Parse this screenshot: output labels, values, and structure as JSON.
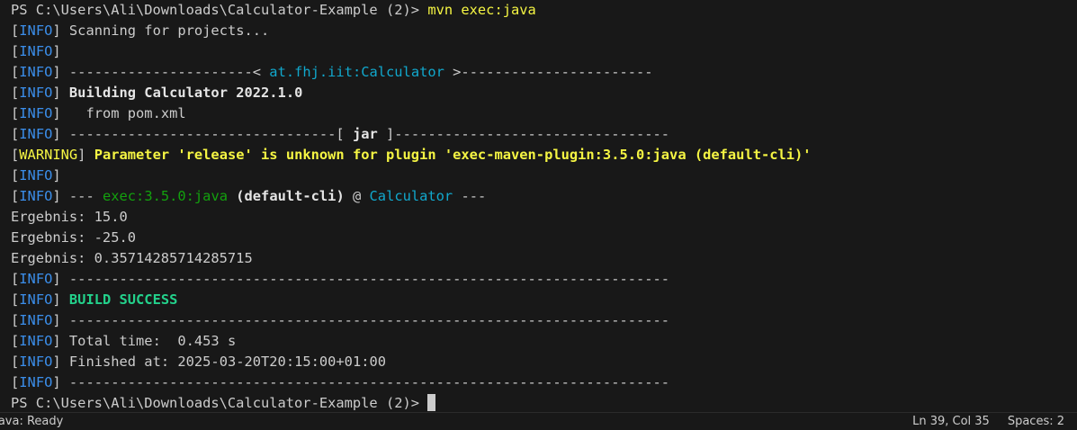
{
  "terminal": {
    "prompt_path": "PS C:\\Users\\Ali\\Downloads\\Calculator-Example (2)> ",
    "command": "mvn exec:java",
    "info_tag": "INFO",
    "warning_tag": "WARNING",
    "lines": {
      "scanning": " Scanning for projects...",
      "dash_left_1": " ----------------------< ",
      "artifact": "at.fhj.iit:Calculator",
      "dash_right_1": " >-----------------------",
      "building": " Building Calculator 2022.1.0",
      "from_pom": "   from pom.xml",
      "dash_left_2": " --------------------------------[ ",
      "jar": "jar",
      "dash_right_2": " ]---------------------------------",
      "warning_msg": " Parameter 'release' is unknown for plugin 'exec-maven-plugin:3.5.0:java (default-cli)'",
      "exec_prefix": " --- ",
      "exec_goal": "exec:3.5.0:java",
      "exec_cli": " (default-cli)",
      "exec_at": " @ ",
      "exec_project": "Calculator",
      "exec_suffix": " ---",
      "result_1": "Ergebnis: 15.0",
      "result_2": "Ergebnis: -25.0",
      "result_3": "Ergebnis: 0.35714285714285715",
      "separator": " ------------------------------------------------------------------------",
      "build_success": " BUILD SUCCESS",
      "total_time": " Total time:  0.453 s",
      "finished_at": " Finished at: 2025-03-20T20:15:00+01:00"
    },
    "final_prompt": "PS C:\\Users\\Ali\\Downloads\\Calculator-Example (2)> "
  },
  "statusbar": {
    "left_text": "Java: Ready",
    "position": "Ln 39, Col 35",
    "spaces": "Spaces: 2"
  }
}
